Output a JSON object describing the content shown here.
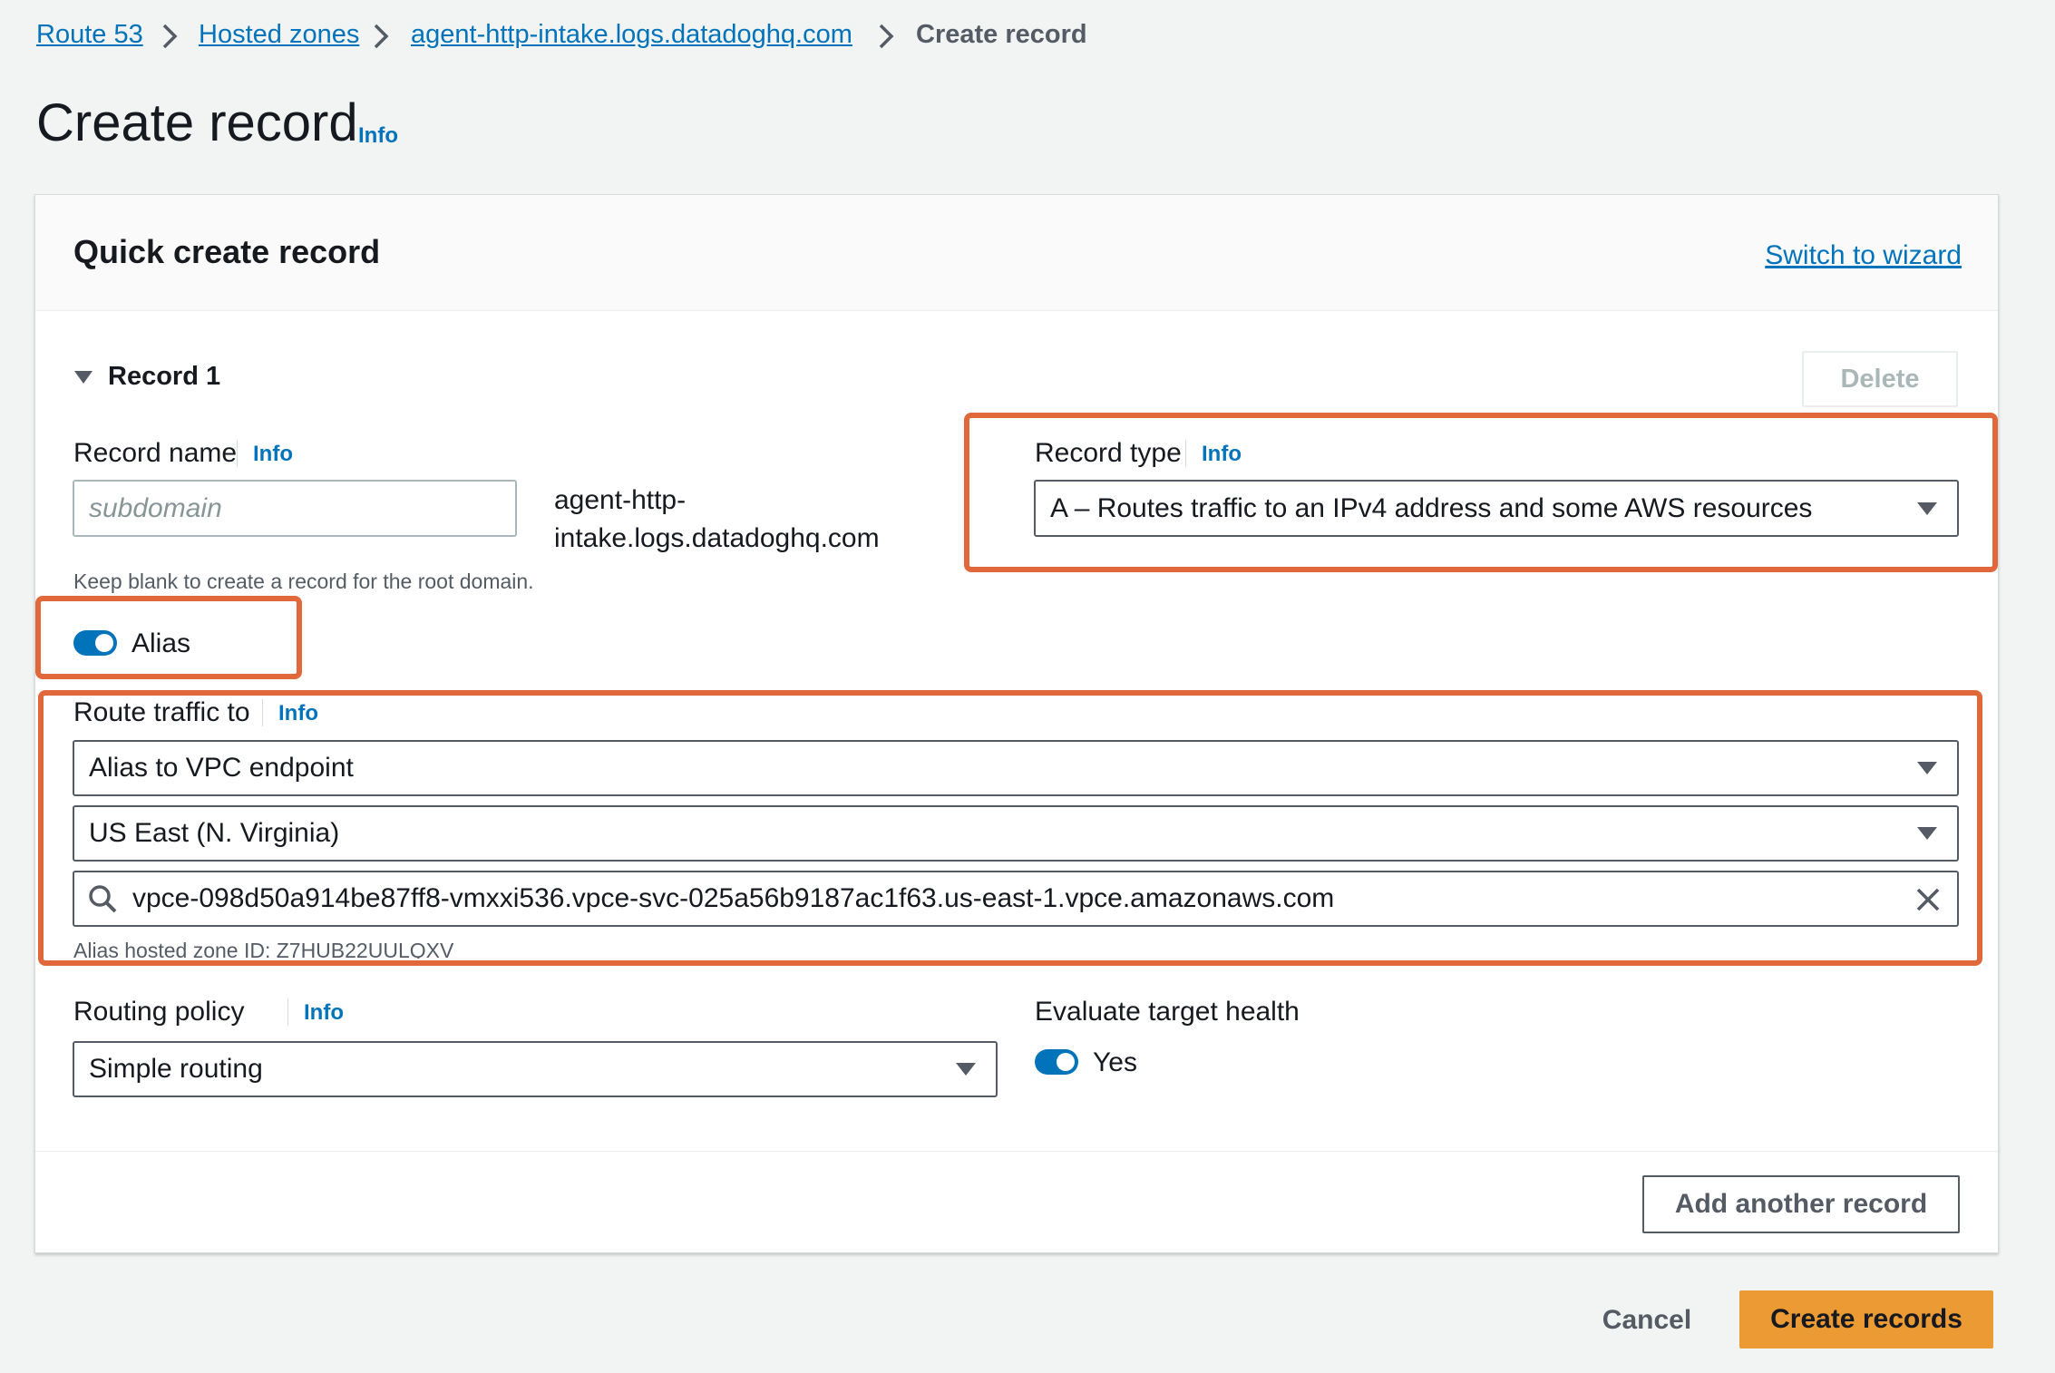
{
  "breadcrumb": {
    "items": [
      "Route 53",
      "Hosted zones",
      "agent-http-intake.logs.datadoghq.com"
    ],
    "current": "Create record"
  },
  "page": {
    "title": "Create record",
    "info": "Info"
  },
  "card": {
    "title": "Quick create record",
    "switch_label": "Switch to wizard"
  },
  "record": {
    "heading": "Record 1",
    "delete_label": "Delete",
    "record_name": {
      "label": "Record name",
      "info": "Info",
      "placeholder": "subdomain",
      "domain_line1": "agent-http-",
      "domain_line2": "intake.logs.datadoghq.com",
      "hint": "Keep blank to create a record for the root domain."
    },
    "record_type": {
      "label": "Record type",
      "info": "Info",
      "value": "A – Routes traffic to an IPv4 address and some AWS resources"
    },
    "alias": {
      "label": "Alias",
      "enabled": true
    },
    "route_traffic": {
      "label": "Route traffic to",
      "info": "Info",
      "endpoint_type": "Alias to VPC endpoint",
      "region": "US East (N. Virginia)",
      "endpoint": "vpce-098d50a914be87ff8-vmxxi536.vpce-svc-025a56b9187ac1f63.us-east-1.vpce.amazonaws.com",
      "hosted_zone_hint": "Alias hosted zone ID: Z7HUB22UULQXV"
    },
    "routing_policy": {
      "label": "Routing policy",
      "info": "Info",
      "value": "Simple routing"
    },
    "target_health": {
      "label": "Evaluate target health",
      "value": "Yes",
      "enabled": true
    }
  },
  "actions": {
    "add_another": "Add another record",
    "cancel": "Cancel",
    "create": "Create records"
  },
  "colors": {
    "link": "#0073bb",
    "primary": "#ec9a34",
    "highlight": "#e0683a",
    "toggle": "#0073bb"
  }
}
